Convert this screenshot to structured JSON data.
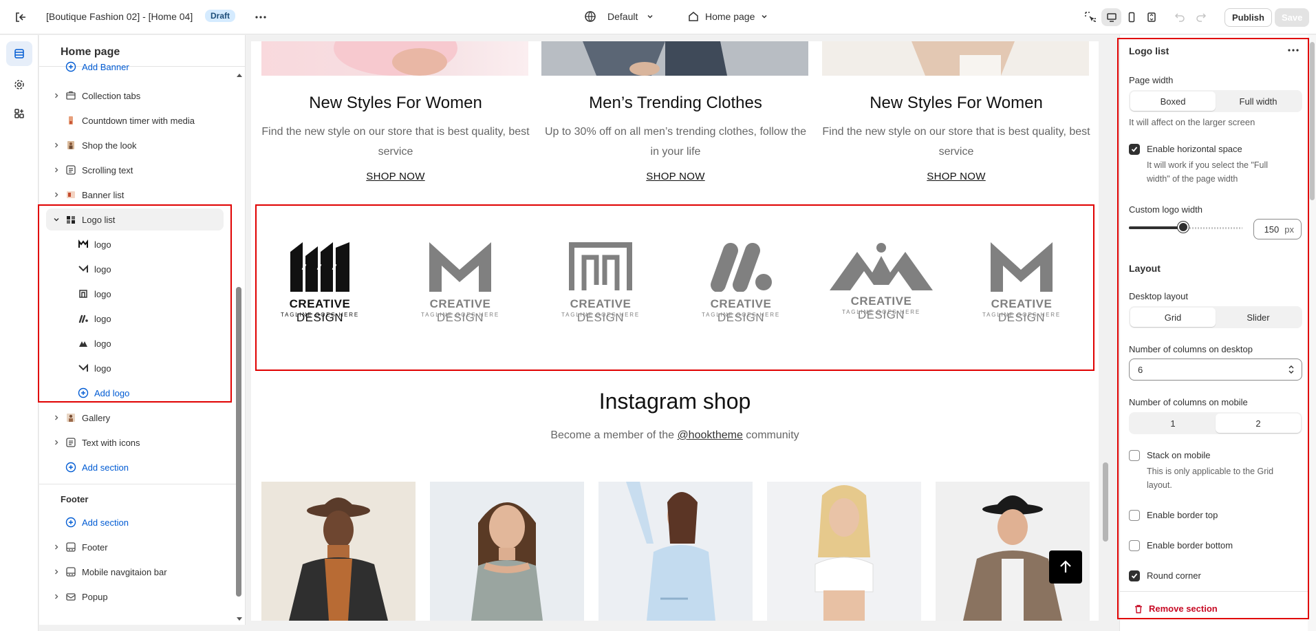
{
  "topbar": {
    "doc_title": "[Boutique Fashion 02] - [Home 04]",
    "status_badge": "Draft",
    "theme_selector": "Default",
    "page_selector": "Home page",
    "publish_label": "Publish",
    "save_label": "Save"
  },
  "sidebar": {
    "title": "Home page",
    "partial_item": "Add Banner",
    "items": [
      {
        "label": "Collection tabs",
        "icon": "tabs-icon"
      },
      {
        "label": "Countdown timer with media",
        "icon": "timer-media-icon"
      },
      {
        "label": "Shop the look",
        "icon": "shop-look-icon"
      },
      {
        "label": "Scrolling text",
        "icon": "text-icon"
      },
      {
        "label": "Banner list",
        "icon": "banner-icon"
      },
      {
        "label": "Logo list",
        "icon": "logo-list-icon"
      }
    ],
    "logo_blocks": [
      "logo",
      "logo",
      "logo",
      "logo",
      "logo",
      "logo"
    ],
    "add_logo_label": "Add logo",
    "after_items": [
      {
        "label": "Gallery",
        "icon": "gallery-icon"
      },
      {
        "label": "Text with icons",
        "icon": "text-icon"
      }
    ],
    "add_section_label": "Add section",
    "footer_group_title": "Footer",
    "footer_add_section_label": "Add section",
    "footer_items": [
      {
        "label": "Footer",
        "icon": "footer-icon"
      },
      {
        "label": "Mobile navgitaion bar",
        "icon": "footer-icon"
      },
      {
        "label": "Popup",
        "icon": "popup-icon"
      }
    ]
  },
  "preview": {
    "columns": [
      {
        "title": "New Styles For Women",
        "desc": "Find the new style on our store that is best quality, best service",
        "link": "SHOP NOW"
      },
      {
        "title": "Men’s Trending Clothes",
        "desc": "Up to 30% off on all men’s trending clothes, follow the in your life",
        "link": "SHOP NOW"
      },
      {
        "title": "New Styles For Women",
        "desc": "Find the new style on our store that is best quality, best service",
        "link": "SHOP NOW"
      }
    ],
    "logos": [
      {
        "word_bold": "CREATIVE",
        "word": " DESIGN",
        "tagline": "TAGLINE GOES HERE",
        "color": "#111111",
        "shape": "m-bars"
      },
      {
        "word_bold": "CREATIVE",
        "word": " DESIGN",
        "tagline": "TAGLINE GOES HERE",
        "color": "#808080",
        "shape": "m-chevron"
      },
      {
        "word_bold": "CREATIVE",
        "word": " DESIGN",
        "tagline": "TAGLINE GOES HERE",
        "color": "#808080",
        "shape": "maze"
      },
      {
        "word_bold": "CREATIVE",
        "word": " DESIGN",
        "tagline": "TAGLINE GOES HERE",
        "color": "#808080",
        "shape": "slashes-dot"
      },
      {
        "word_bold": "CREATIVE",
        "word": " DESIGN",
        "tagline": "TAGLINE GOES HERE",
        "color": "#808080",
        "shape": "peaks"
      },
      {
        "word_bold": "CREATIVE",
        "word": " DESIGN",
        "tagline": "TAGLINE GOES HERE",
        "color": "#808080",
        "shape": "m-chevron"
      }
    ],
    "instagram_title": "Instagram shop",
    "instagram_sub_before": "Become a member of the ",
    "instagram_handle": "@hooktheme",
    "instagram_sub_after": " community"
  },
  "settings": {
    "panel_title": "Logo list",
    "page_width_label": "Page width",
    "page_width_options": [
      "Boxed",
      "Full width"
    ],
    "page_width_selected": "Boxed",
    "page_width_help": "It will affect on the larger screen",
    "horizontal_space_label": "Enable horizontal space",
    "horizontal_space_checked": true,
    "horizontal_space_help": "It will work if you select the \"Full width\" of the page width",
    "logo_width_label": "Custom logo width",
    "logo_width_value": "150",
    "logo_width_unit": "px",
    "logo_width_fraction": 0.48,
    "layout_heading": "Layout",
    "desktop_layout_label": "Desktop layout",
    "desktop_layout_options": [
      "Grid",
      "Slider"
    ],
    "desktop_layout_selected": "Grid",
    "desktop_columns_label": "Number of columns on desktop",
    "desktop_columns_value": "6",
    "mobile_columns_label": "Number of columns on mobile",
    "mobile_columns_options": [
      "1",
      "2"
    ],
    "mobile_columns_selected": "2",
    "stack_mobile_label": "Stack on mobile",
    "stack_mobile_checked": false,
    "stack_mobile_help": "This is only applicable to the Grid layout.",
    "border_top_label": "Enable border top",
    "border_top_checked": false,
    "border_bottom_label": "Enable border bottom",
    "border_bottom_checked": false,
    "round_corner_label": "Round corner",
    "round_corner_checked": true,
    "remove_label": "Remove section"
  },
  "colors": {
    "accent": "#005bd3",
    "highlight": "#e00000",
    "danger": "#c70a24"
  }
}
